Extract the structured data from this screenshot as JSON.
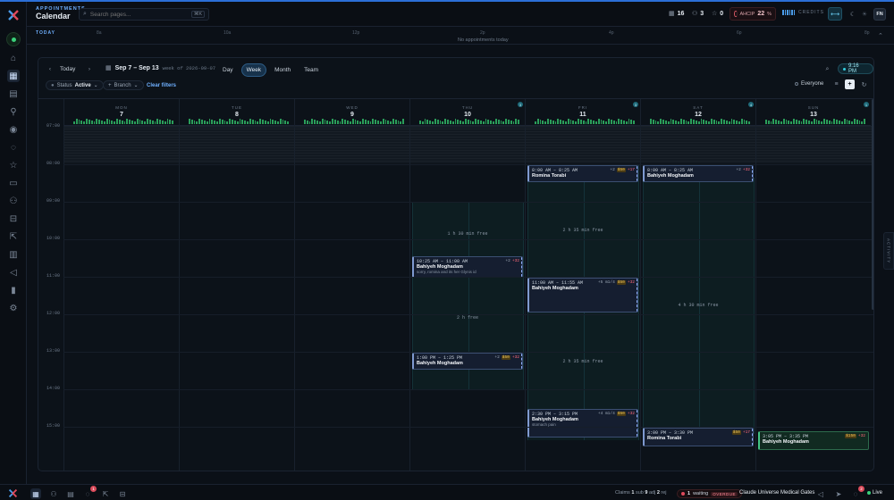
{
  "header": {
    "section": "APPOINTMENTS",
    "title": "Calendar",
    "search_placeholder": "Search pages...",
    "search_shortcut": "⌘K",
    "stats": [
      {
        "icon": "calendar-icon",
        "value": "16"
      },
      {
        "icon": "users-icon",
        "value": "3"
      },
      {
        "icon": "star-icon",
        "value": "0"
      }
    ],
    "ahcip_label": "AHCIP",
    "ahcip_value": "22",
    "ahcip_suffix": "%",
    "credits_label": "CREDITS",
    "avatar_initials": "FN"
  },
  "today_strip": {
    "label": "TODAY",
    "ticks": [
      "8a",
      "10a",
      "12p",
      "2p",
      "4p",
      "6p",
      "8p"
    ],
    "message": "No appointments today"
  },
  "toolbar": {
    "today": "Today",
    "range": "Sep 7 – Sep 13",
    "range_sub": "week of 2026-09-07",
    "views": [
      "Day",
      "Week",
      "Month",
      "Team"
    ],
    "active_view": "Week",
    "time": "9:16 PM",
    "status_label": "Status",
    "status_value": "Active",
    "branch_label": "Branch",
    "clear_filters": "Clear filters",
    "everyone": "Everyone"
  },
  "hours": [
    "07:00",
    "08:00",
    "09:00",
    "10:00",
    "11:00",
    "12:00",
    "13:00",
    "14:00",
    "15:00"
  ],
  "days": [
    {
      "name": "MON",
      "num": "7",
      "badge": ""
    },
    {
      "name": "TUE",
      "num": "8",
      "badge": ""
    },
    {
      "name": "WED",
      "num": "9",
      "badge": ""
    },
    {
      "name": "THU",
      "num": "10",
      "badge": "3"
    },
    {
      "name": "FRI",
      "num": "11",
      "badge": "3"
    },
    {
      "name": "SAT",
      "num": "12",
      "badge": "4"
    },
    {
      "name": "SUN",
      "num": "13",
      "badge": "1"
    }
  ],
  "free_labels": [
    {
      "day": 3,
      "text": "1 h 30 min free"
    },
    {
      "day": 3,
      "text": "2 h free"
    },
    {
      "day": 4,
      "text": "2 h 35 min free"
    },
    {
      "day": 4,
      "text": "2 h 35 min free"
    },
    {
      "day": 5,
      "text": "4 h 30 min free"
    }
  ],
  "appointments": [
    {
      "day": 3,
      "time": "10:25 AM – 11:00 AM",
      "name": "Bahiyeh Moghadam",
      "note": "sorry, romina and its her Glynis id",
      "tag_g": "+2",
      "tag_y": "",
      "tag_r": "+32"
    },
    {
      "day": 3,
      "time": "1:00 PM – 1:25 PM",
      "name": "Bahiyeh Moghadam",
      "note": "",
      "tag_g": "+2",
      "tag_y": "$50",
      "tag_r": "+32"
    },
    {
      "day": 4,
      "time": "8:00 AM – 8:25 AM",
      "name": "Romina Torabi",
      "note": "",
      "tag_g": "+2",
      "tag_y": "$50",
      "tag_r": "+17"
    },
    {
      "day": 4,
      "time": "11:00 AM – 11:55 AM",
      "name": "Bahiyeh Moghadam",
      "note": "",
      "tag_g": "+5 m1/4",
      "tag_y": "$50",
      "tag_r": "+32"
    },
    {
      "day": 4,
      "time": "2:30 PM – 3:15 PM",
      "name": "Bahiyeh Moghadam",
      "note": "stomach pain",
      "tag_g": "+4 m1/4",
      "tag_y": "$50",
      "tag_r": "+32"
    },
    {
      "day": 5,
      "time": "8:00 AM – 8:25 AM",
      "name": "Bahiyeh Moghadam",
      "note": "",
      "tag_g": "+2",
      "tag_y": "",
      "tag_r": "+32"
    },
    {
      "day": 5,
      "time": "3:00 PM – 3:30 PM",
      "name": "Romina Torabi",
      "note": "",
      "tag_g": "",
      "tag_y": "$50",
      "tag_r": "+17"
    },
    {
      "day": 6,
      "time": "3:05 PM – 3:35 PM",
      "name": "Bahiyeh Moghadam",
      "note": "",
      "tag_g": "",
      "tag_y": "$150",
      "tag_r": "+32"
    }
  ],
  "activity_label": "ACTIVITY",
  "bottom": {
    "notif_count": "1",
    "claims_label": "Claims",
    "claims_value": "1",
    "sub_label": "sub",
    "sub_value": "9",
    "adj_label": "adj",
    "adj_value": "2",
    "rej_label": "rej",
    "waiting_count": "1",
    "waiting_label": "waiting",
    "overdue_label": "OVERDUE",
    "org": "Claude Universe Medical Gates",
    "alerts_count": "2",
    "live": "Live"
  },
  "colors": {
    "accent": "#2b6fd6",
    "available": "#0d1d21",
    "appointment": "#151e30",
    "green": "#43c483",
    "alert": "#d94a5a"
  }
}
